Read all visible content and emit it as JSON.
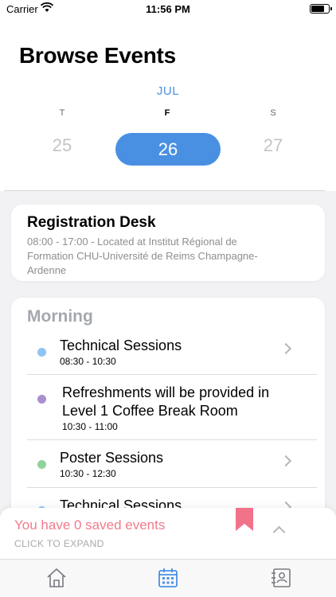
{
  "status_bar": {
    "carrier": "Carrier",
    "time": "11:56 PM"
  },
  "header": {
    "title": "Browse Events",
    "month": "JUL",
    "days": [
      {
        "letter": "T",
        "number": "25",
        "selected": false
      },
      {
        "letter": "F",
        "number": "26",
        "selected": true
      },
      {
        "letter": "S",
        "number": "27",
        "selected": false
      }
    ]
  },
  "registration": {
    "title": "Registration Desk",
    "details_line1": "08:00 - 17:00 - Located at Institut Régional de",
    "details_line2": "Formation CHU-Université de Reims Champagne-",
    "details_line3": "Ardenne"
  },
  "schedule": {
    "section_title": "Morning",
    "sessions": [
      {
        "name_line1": "Technical Sessions",
        "name_line2": "",
        "time": "08:30 - 10:30",
        "color": "#8ec4f2",
        "has_chevron": true
      },
      {
        "name_line1": "Refreshments will be provided in",
        "name_line2": "Level 1 Coffee Break Room",
        "time": "10:30 - 11:00",
        "color": "#a88fd0",
        "has_chevron": false
      },
      {
        "name_line1": "Poster Sessions",
        "name_line2": "",
        "time": "10:30 - 12:30",
        "color": "#8fd39e",
        "has_chevron": true
      },
      {
        "name_line1": "Technical Sessions",
        "name_line2": "",
        "time": "",
        "color": "#8ec4f2",
        "has_chevron": true
      }
    ]
  },
  "saved_panel": {
    "message": "You have 0 saved events",
    "expand_label": "CLICK TO EXPAND",
    "bookmark_color": "#f2728a"
  },
  "tabs": [
    {
      "icon": "home-icon"
    },
    {
      "icon": "calendar-icon",
      "active": true
    },
    {
      "icon": "contact-card-icon"
    }
  ],
  "colors": {
    "accent": "#4a90e2",
    "saved": "#f27a8c"
  }
}
